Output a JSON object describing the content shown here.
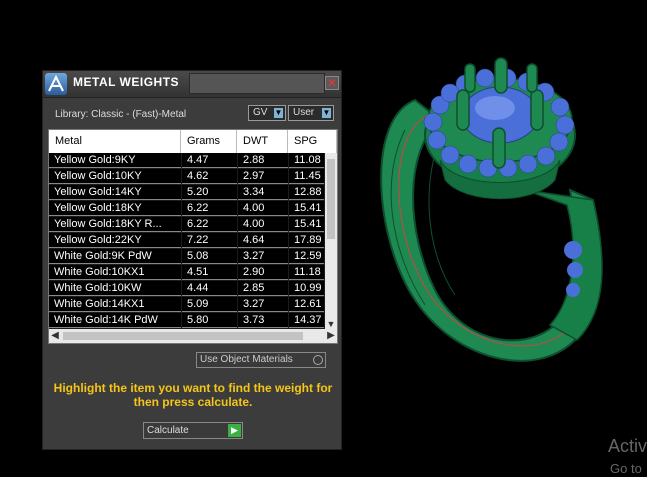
{
  "window": {
    "title": "METAL WEIGHTS",
    "close_glyph": "✕",
    "logo_icon": "app-logo-icon"
  },
  "library_label": "Library: Classic - (Fast)-Metal",
  "gv_button": {
    "label": "GV"
  },
  "user_button": {
    "label": "User"
  },
  "table": {
    "columns": [
      "Metal",
      "Grams",
      "DWT",
      "SPG"
    ],
    "rows": [
      [
        "Yellow Gold:9KY",
        "4.47",
        "2.88",
        "11.08"
      ],
      [
        "Yellow Gold:10KY",
        "4.62",
        "2.97",
        "11.45"
      ],
      [
        "Yellow Gold:14KY",
        "5.20",
        "3.34",
        "12.88"
      ],
      [
        "Yellow Gold:18KY",
        "6.22",
        "4.00",
        "15.41"
      ],
      [
        "Yellow Gold:18KY R...",
        "6.22",
        "4.00",
        "15.41"
      ],
      [
        "Yellow Gold:22KY",
        "7.22",
        "4.64",
        "17.89"
      ],
      [
        "White Gold:9K PdW",
        "5.08",
        "3.27",
        "12.59"
      ],
      [
        "White Gold:10KX1",
        "4.51",
        "2.90",
        "11.18"
      ],
      [
        "White Gold:10KW",
        "4.44",
        "2.85",
        "10.99"
      ],
      [
        "White Gold:14KX1",
        "5.09",
        "3.27",
        "12.61"
      ],
      [
        "White Gold:14K PdW",
        "5.80",
        "3.73",
        "14.37"
      ]
    ]
  },
  "use_object_materials": {
    "label": "Use Object Materials"
  },
  "instruction": "Highlight the item you want to find the weight for then press calculate.",
  "calculate_button": {
    "label": "Calculate"
  },
  "watermark": {
    "line1": "Activ",
    "line2": "Go to"
  },
  "colors": {
    "ring_green": "#1e8a52",
    "ring_dark": "#0d4f2e",
    "gem_blue": "#4a6fd8",
    "instruction_yellow": "#f5c518"
  }
}
